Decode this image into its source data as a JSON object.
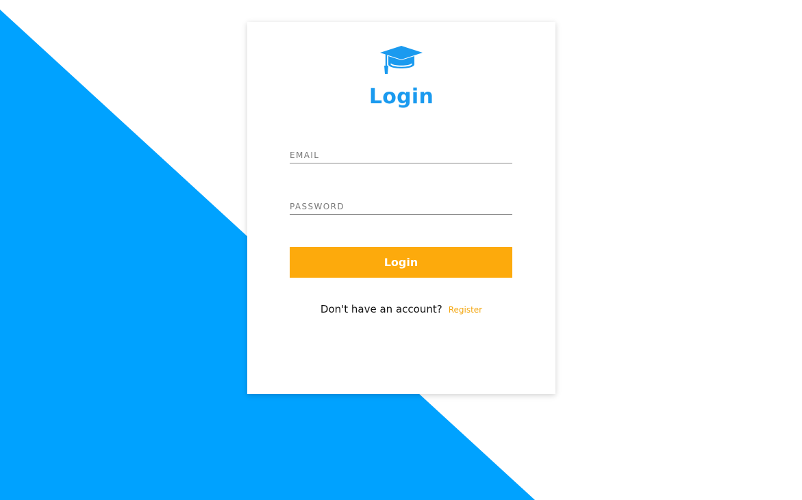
{
  "colors": {
    "background": "#ffffff",
    "accent_blue": "#00a2ff",
    "title_blue": "#1a9aef",
    "button_orange": "#fdaa0c",
    "link_orange": "#f3a712"
  },
  "logo": {
    "icon": "graduation-cap-icon"
  },
  "card": {
    "title": "Login"
  },
  "form": {
    "email": {
      "placeholder": "EMAIL",
      "value": ""
    },
    "password": {
      "placeholder": "PASSWORD",
      "value": ""
    },
    "submit_label": "Login"
  },
  "footer": {
    "prompt": "Don't have an account?",
    "register_label": "Register"
  }
}
